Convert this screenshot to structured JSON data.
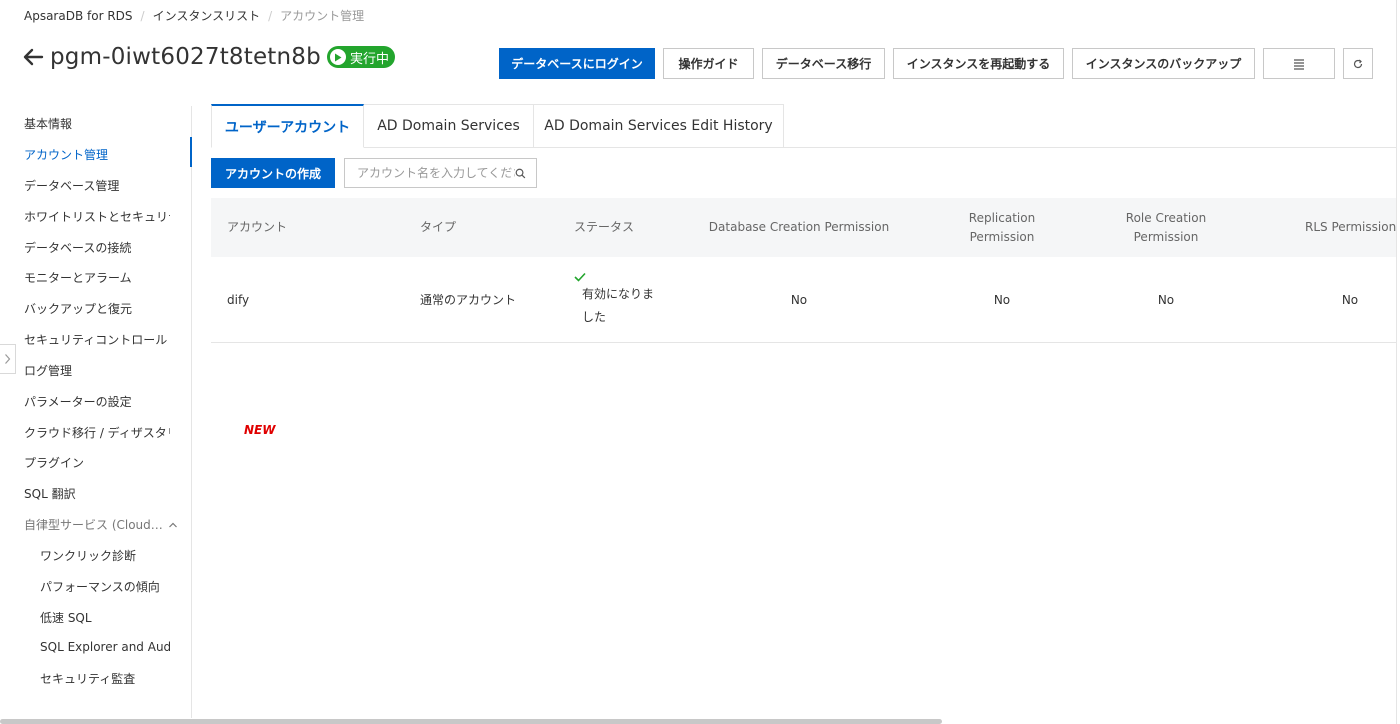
{
  "breadcrumb": [
    "ApsaraDB for RDS",
    "インスタンスリスト",
    "アカウント管理"
  ],
  "header": {
    "title": "pgm-0iwt6027t8tetn8b",
    "status": "実行中"
  },
  "toolbar": {
    "login": "データベースにログイン",
    "guide": "操作ガイド",
    "migrate": "データベース移行",
    "restart": "インスタンスを再起動する",
    "backup": "インスタンスのバックアップ"
  },
  "sidebar": {
    "items": [
      "基本情報",
      "アカウント管理",
      "データベース管理",
      "ホワイトリストとセキュリティ",
      "データベースの接続",
      "モニターとアラーム",
      "バックアップと復元",
      "セキュリティコントロール",
      "ログ管理",
      "パラメーターの設定",
      "クラウド移行 / ディザスタリカバリ",
      "プラグイン",
      "SQL 翻訳"
    ],
    "group": "自律型サービス (CloudDBA)",
    "sub_items": [
      "ワンクリック診断",
      "パフォーマンスの傾向",
      "低速 SQL",
      "SQL Explorer and Audit",
      "セキュリティ監査"
    ]
  },
  "tabs": [
    "ユーザーアカウント",
    "AD Domain Services",
    "AD Domain Services Edit History"
  ],
  "actions": {
    "create": "アカウントの作成",
    "search_placeholder": "アカウント名を入力してください"
  },
  "table": {
    "headers": {
      "account": "アカウント",
      "type": "タイプ",
      "status": "ステータス",
      "db_creation": "Database Creation Permission",
      "replication": "Replication Permission",
      "role_creation": "Role Creation Permission",
      "rls": "RLS Permission"
    },
    "rows": [
      {
        "account": "dify",
        "type": "通常のアカウント",
        "status": "有効になりました",
        "db_creation": "No",
        "replication": "No",
        "role_creation": "No",
        "rls": "No"
      }
    ]
  },
  "badge_new": "NEW",
  "colors": {
    "primary": "#0064c8",
    "running": "#23a52d",
    "new": "#e00000",
    "success": "#23a52d"
  }
}
